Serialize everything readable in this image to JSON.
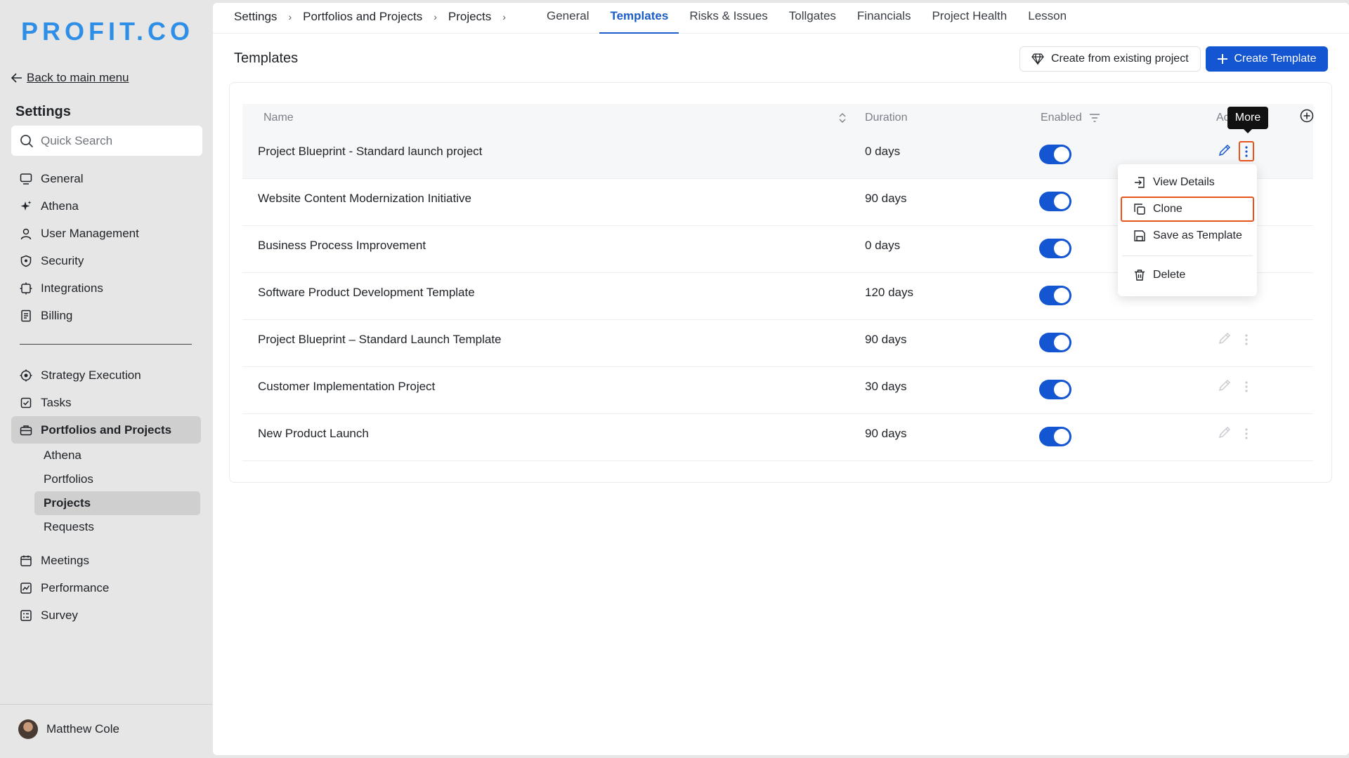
{
  "brand": {
    "logo": "PROFIT.CO"
  },
  "sidebar": {
    "back_label": "Back to main menu",
    "title": "Settings",
    "search_placeholder": "Quick Search",
    "items_top": [
      {
        "label": "General",
        "icon": "monitor-icon"
      },
      {
        "label": "Athena",
        "icon": "sparkle-icon"
      },
      {
        "label": "User Management",
        "icon": "user-icon"
      },
      {
        "label": "Security",
        "icon": "shield-icon"
      },
      {
        "label": "Integrations",
        "icon": "puzzle-icon"
      },
      {
        "label": "Billing",
        "icon": "receipt-icon"
      }
    ],
    "items_bottom": [
      {
        "label": "Strategy Execution",
        "icon": "target-icon"
      },
      {
        "label": "Tasks",
        "icon": "checkbox-icon"
      },
      {
        "label": "Portfolios and Projects",
        "icon": "briefcase-icon",
        "active": true
      }
    ],
    "sub_items": [
      {
        "label": "Athena"
      },
      {
        "label": "Portfolios"
      },
      {
        "label": "Projects",
        "active": true
      },
      {
        "label": "Requests"
      }
    ],
    "items_more": [
      {
        "label": "Meetings",
        "icon": "calendar-icon"
      },
      {
        "label": "Performance",
        "icon": "chart-icon"
      },
      {
        "label": "Survey",
        "icon": "survey-icon"
      }
    ],
    "user_name": "Matthew Cole"
  },
  "breadcrumb": [
    "Settings",
    "Portfolios and Projects",
    "Projects"
  ],
  "tabs": [
    {
      "label": "General"
    },
    {
      "label": "Templates",
      "active": true
    },
    {
      "label": "Risks & Issues"
    },
    {
      "label": "Tollgates"
    },
    {
      "label": "Financials"
    },
    {
      "label": "Project Health"
    },
    {
      "label": "Lesson"
    }
  ],
  "page": {
    "title": "Templates",
    "create_from_existing_label": "Create from existing project",
    "create_template_label": "Create Template"
  },
  "table": {
    "columns": {
      "name": "Name",
      "duration": "Duration",
      "enabled": "Enabled",
      "actions": "Ac"
    },
    "rows": [
      {
        "name": "Project Blueprint - Standard launch project",
        "duration": "0 days",
        "enabled": true
      },
      {
        "name": "Website Content Modernization Initiative",
        "duration": "90 days",
        "enabled": true
      },
      {
        "name": "Business Process Improvement",
        "duration": "0 days",
        "enabled": true
      },
      {
        "name": "Software Product Development Template",
        "duration": "120 days",
        "enabled": true
      },
      {
        "name": "Project Blueprint – Standard Launch Template",
        "duration": "90 days",
        "enabled": true
      },
      {
        "name": "Customer Implementation Project",
        "duration": "30 days",
        "enabled": true
      },
      {
        "name": "New Product Launch",
        "duration": "90 days",
        "enabled": true
      }
    ]
  },
  "tooltip": "More",
  "context_menu": {
    "items": [
      {
        "label": "View Details",
        "icon": "open-in-icon"
      },
      {
        "label": "Clone",
        "icon": "copy-icon"
      },
      {
        "label": "Save as Template",
        "icon": "save-icon"
      },
      {
        "label": "Delete",
        "icon": "trash-icon"
      }
    ]
  },
  "colors": {
    "accent": "#1455d1",
    "focus": "#e8541e",
    "logo": "#2f8fe6"
  }
}
